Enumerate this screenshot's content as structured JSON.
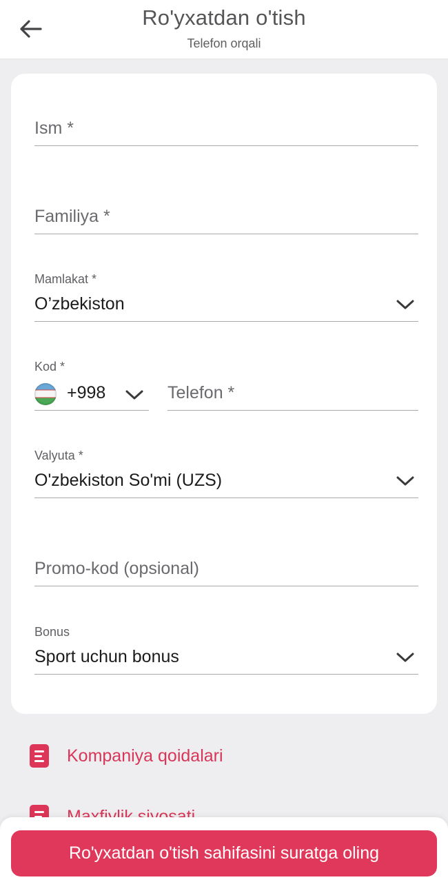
{
  "header": {
    "title": "Ro'yxatdan o'tish",
    "subtitle": "Telefon orqali"
  },
  "form": {
    "first_name": {
      "placeholder": "Ism *"
    },
    "last_name": {
      "placeholder": "Familiya *"
    },
    "country": {
      "label": "Mamlakat *",
      "value": "O’zbekiston"
    },
    "code": {
      "label": "Kod *",
      "value": "+998",
      "flag": "uzbekistan-flag"
    },
    "phone": {
      "placeholder": "Telefon *"
    },
    "currency": {
      "label": "Valyuta *",
      "value": "O'zbekiston So'mi (UZS)"
    },
    "promo": {
      "placeholder": "Promo-kod (opsional)"
    },
    "bonus": {
      "label": "Bonus",
      "value": "Sport uchun bonus"
    }
  },
  "links": [
    {
      "label": "Kompaniya qoidalari",
      "icon": "document-icon"
    },
    {
      "label": "Maxfiylik siyosati",
      "icon": "document-icon"
    }
  ],
  "submit": {
    "label": "Ro'yxatdan o'tish sahifasini suratga oling"
  },
  "colors": {
    "accent": "#e0385a",
    "link": "#d83658",
    "background": "#eeeef0",
    "card": "#ffffff"
  }
}
